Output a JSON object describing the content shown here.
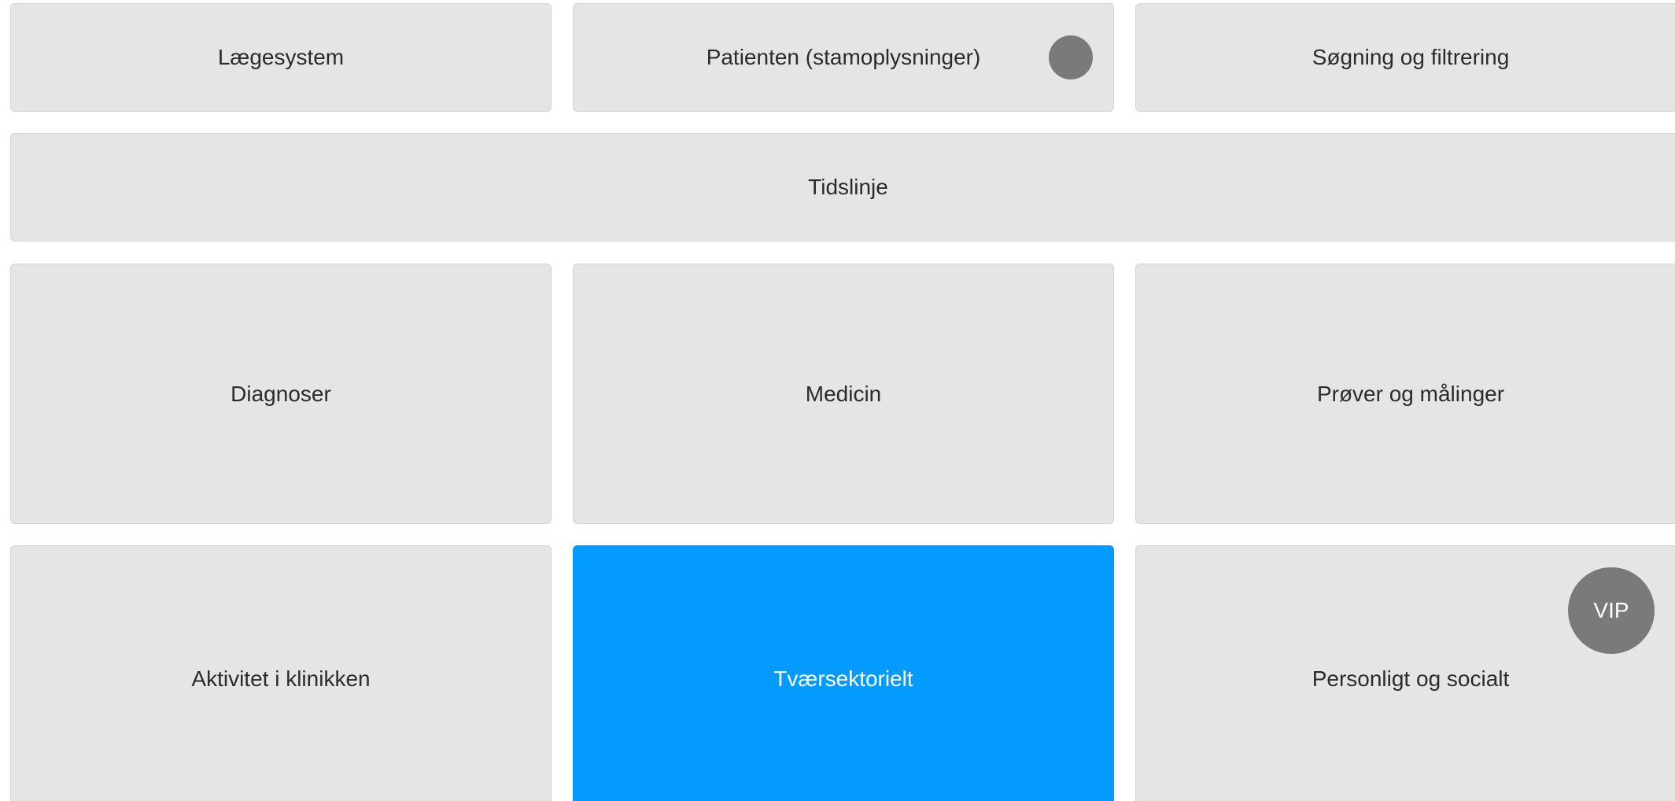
{
  "tiles": {
    "laegesystem": "Lægesystem",
    "patienten": "Patienten (stamoplysninger)",
    "soegning": "Søgning og filtrering",
    "tidslinje": "Tidslinje",
    "diagnoser": "Diagnoser",
    "medicin": "Medicin",
    "proever": "Prøver og målinger",
    "aktivitet": "Aktivitet i klinikken",
    "tvaersektorielt": "Tværsektorielt",
    "personligt": "Personligt og socialt"
  },
  "badges": {
    "vip": "VIP"
  },
  "active_tile": "Tværsektorielt",
  "colors": {
    "tile_background": "#e5e5e5",
    "active_tile_background": "#039bff",
    "badge_background": "#7a7a7a",
    "text": "#2b2b2b"
  }
}
